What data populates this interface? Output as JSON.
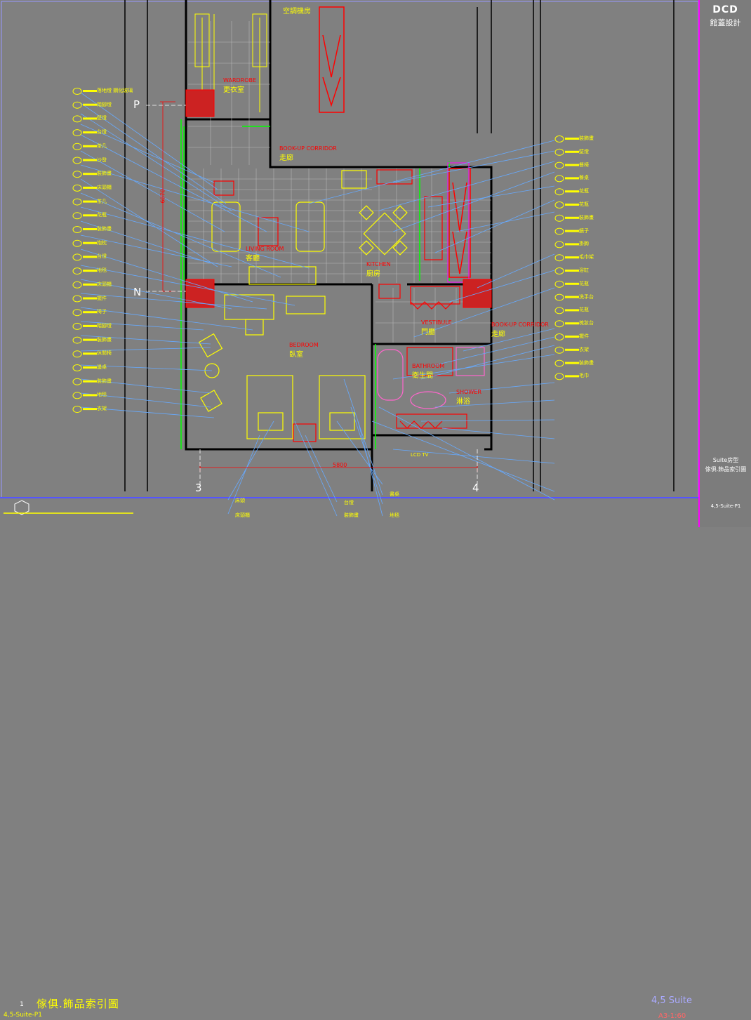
{
  "drawing": {
    "title": "傢俱.飾品索引圖",
    "subtitle": "4,5-Suite-P1",
    "number": "1",
    "suite_tag": "4,5 Suite",
    "scale": "A3-1:60"
  },
  "title_block": {
    "logo": "DCD",
    "logo_sub": "館蓋設計",
    "project": "Suite房型",
    "sheet": "傢俱.飾品索引圖",
    "code": "4,5-Suite-P1"
  },
  "rooms": [
    {
      "en": "WARDROBE",
      "zh": "更衣室"
    },
    {
      "en": "BOOK-UP CORRIDOR",
      "zh": "走廊"
    },
    {
      "en": "LIVING ROOM",
      "zh": "客廳"
    },
    {
      "en": "KITCHEN",
      "zh": "廚房"
    },
    {
      "en": "VESTIBULE",
      "zh": "門廳"
    },
    {
      "en": "BOOK-UP CORRIDOR",
      "zh": "走廊"
    },
    {
      "en": "BEDROOM",
      "zh": "臥室"
    },
    {
      "en": "BATHROOM",
      "zh": "衛生間"
    },
    {
      "en": "SHOWER",
      "zh": "淋浴"
    }
  ],
  "top_label": "空調機房",
  "grid_marks": {
    "p": "P",
    "n": "N",
    "c3": "3",
    "c4": "4"
  },
  "dims": {
    "width": "5800",
    "height": "6070"
  },
  "left_tags": [
    "落地燈 鋼化玻璃",
    "踏腳燈",
    "壁燈",
    "台燈",
    "茶几",
    "沙發",
    "裝飾畫",
    "床頭櫃",
    "茶几",
    "花瓶",
    "裝飾畫",
    "抱枕",
    "台燈",
    "地毯",
    "床頭櫃",
    "擺件",
    "椅子",
    "踏腳燈",
    "裝飾畫",
    "休閒椅",
    "邊桌",
    "裝飾畫",
    "地毯",
    "衣架"
  ],
  "right_tags": [
    "裝飾畫",
    "壁燈",
    "餐椅",
    "餐桌",
    "花瓶",
    "花瓶",
    "裝飾畫",
    "鏡子",
    "掛鉤",
    "毛巾架",
    "浴缸",
    "花瓶",
    "洗手台",
    "花瓶",
    "梳妝台",
    "擺件",
    "衣架",
    "裝飾畫",
    "毛巾"
  ],
  "bottom_tags": [
    "床頭",
    "床頭櫃",
    "台燈",
    "裝飾畫",
    "LCD TV",
    "書桌",
    "地毯"
  ]
}
